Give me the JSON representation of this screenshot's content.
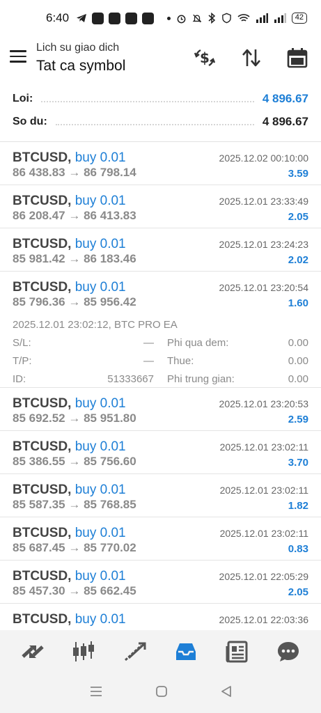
{
  "status": {
    "time": "6:40",
    "battery": "42"
  },
  "header": {
    "subtitle": "Lich su giao dich",
    "title": "Tat ca symbol"
  },
  "summary": {
    "profit_label": "Loi:",
    "profit_value": "4 896.67",
    "balance_label": "So du:",
    "balance_value": "4 896.67"
  },
  "deals": [
    {
      "symbol": "BTCUSD,",
      "type": "buy 0.01",
      "time": "2025.12.02 00:10:00",
      "prices": "86 438.83 → 86 798.14",
      "profit": "3.59"
    },
    {
      "symbol": "BTCUSD,",
      "type": "buy 0.01",
      "time": "2025.12.01 23:33:49",
      "prices": "86 208.47 → 86 413.83",
      "profit": "2.05"
    },
    {
      "symbol": "BTCUSD,",
      "type": "buy 0.01",
      "time": "2025.12.01 23:24:23",
      "prices": "85 981.42 → 86 183.46",
      "profit": "2.02"
    },
    {
      "symbol": "BTCUSD,",
      "type": "buy 0.01",
      "time": "2025.12.01 23:20:54",
      "prices": "85 796.36 → 85 956.42",
      "profit": "1.60",
      "detail": {
        "open": "2025.12.01 23:02:12, BTC PRO EA",
        "sl_label": "S/L:",
        "sl_value": "—",
        "swap_label": "Phi qua dem:",
        "swap_value": "0.00",
        "tp_label": "T/P:",
        "tp_value": "—",
        "tax_label": "Thue:",
        "tax_value": "0.00",
        "id_label": "ID:",
        "id_value": "51333667",
        "comm_label": "Phi trung gian:",
        "comm_value": "0.00"
      }
    },
    {
      "symbol": "BTCUSD,",
      "type": "buy 0.01",
      "time": "2025.12.01 23:20:53",
      "prices": "85 692.52 → 85 951.80",
      "profit": "2.59"
    },
    {
      "symbol": "BTCUSD,",
      "type": "buy 0.01",
      "time": "2025.12.01 23:02:11",
      "prices": "85 386.55 → 85 756.60",
      "profit": "3.70"
    },
    {
      "symbol": "BTCUSD,",
      "type": "buy 0.01",
      "time": "2025.12.01 23:02:11",
      "prices": "85 587.35 → 85 768.85",
      "profit": "1.82"
    },
    {
      "symbol": "BTCUSD,",
      "type": "buy 0.01",
      "time": "2025.12.01 23:02:11",
      "prices": "85 687.45 → 85 770.02",
      "profit": "0.83"
    },
    {
      "symbol": "BTCUSD,",
      "type": "buy 0.01",
      "time": "2025.12.01 22:05:29",
      "prices": "85 457.30 → 85 662.45",
      "profit": "2.05"
    },
    {
      "symbol": "BTCUSD,",
      "type": "buy 0.01",
      "time": "2025.12.01 22:03:36",
      "prices": "",
      "profit": ""
    }
  ],
  "colors": {
    "accent": "#1e7fd6",
    "muted": "#8a8a8a",
    "nav_bg": "#f3f3f3"
  },
  "icons": {
    "header": [
      "currency-exchange-icon",
      "sort-icon",
      "calendar-icon"
    ],
    "bottom_nav": [
      "quotes-icon",
      "chart-icon",
      "trade-icon",
      "history-icon",
      "news-icon",
      "chat-icon"
    ],
    "bottom_nav_active": "history-icon"
  }
}
